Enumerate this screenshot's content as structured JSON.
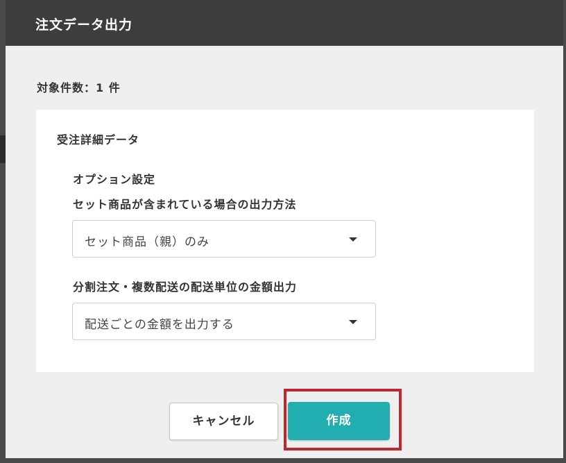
{
  "dialog": {
    "title": "注文データ出力",
    "target_count": "対象件数：1 件",
    "panel": {
      "title": "受注詳細データ",
      "options_heading": "オプション設定",
      "fields": [
        {
          "label": "セット商品が含まれている場合の出力方法",
          "selected_value": "セット商品（親）のみ"
        },
        {
          "label": "分割注文・複数配送の配送単位の金額出力",
          "selected_value": "配送ごとの金額を出力する"
        }
      ]
    },
    "buttons": {
      "cancel": "キャンセル",
      "create": "作成"
    },
    "colors": {
      "header_bg": "#3d3d3d",
      "primary_button": "#22aeb0",
      "highlight": "#c0262d"
    }
  }
}
